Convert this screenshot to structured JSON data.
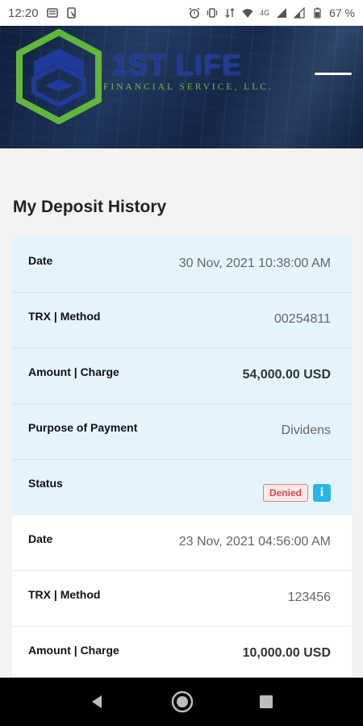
{
  "status_bar": {
    "time": "12:20",
    "network": "4G",
    "battery": "67 %"
  },
  "header": {
    "brand_name": "1ST LIFE",
    "brand_sub": "FINANCIAL SERVICE, LLC.",
    "colors": {
      "brand_blue": "#1e3a9a",
      "brand_green": "#6cbf3a"
    }
  },
  "page": {
    "title": "My Deposit History"
  },
  "deposits": [
    {
      "date_label": "Date",
      "date": "30 Nov, 2021 10:38:00 AM",
      "trx_label": "TRX | Method",
      "trx": "00254811",
      "amount_label": "Amount | Charge",
      "amount": "54,000.00 USD",
      "purpose_label": "Purpose of Payment",
      "purpose": "Dividens",
      "status_label": "Status",
      "status": "Denied"
    },
    {
      "date_label": "Date",
      "date": "23 Nov, 2021 04:56:00 AM",
      "trx_label": "TRX | Method",
      "trx": "123456",
      "amount_label": "Amount | Charge",
      "amount": "10,000.00 USD"
    }
  ],
  "icons": {
    "info": "info-icon",
    "menu": "hamburger-menu-icon",
    "back": "back-icon",
    "home": "home-icon",
    "recents": "recents-icon"
  }
}
